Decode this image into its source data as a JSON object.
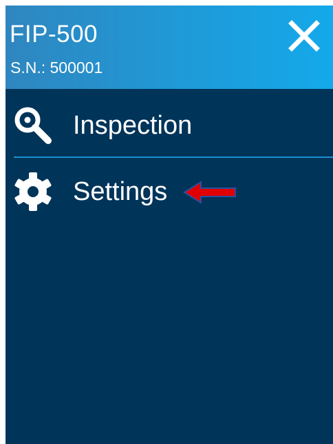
{
  "header": {
    "title": "FIP-500",
    "serial": "S.N.: 500001",
    "close_icon": "close-icon"
  },
  "menu": {
    "items": [
      {
        "label": "Inspection",
        "icon": "magnifier-icon"
      },
      {
        "label": "Settings",
        "icon": "gear-icon"
      }
    ]
  },
  "annotation": {
    "icon": "arrow-left-icon"
  },
  "colors": {
    "background": "#003459",
    "header_gradient_start": "#2f86bf",
    "header_gradient_end": "#14a9ea",
    "divider": "#1d8fd0",
    "arrow": "#e00000",
    "text": "#ffffff"
  }
}
